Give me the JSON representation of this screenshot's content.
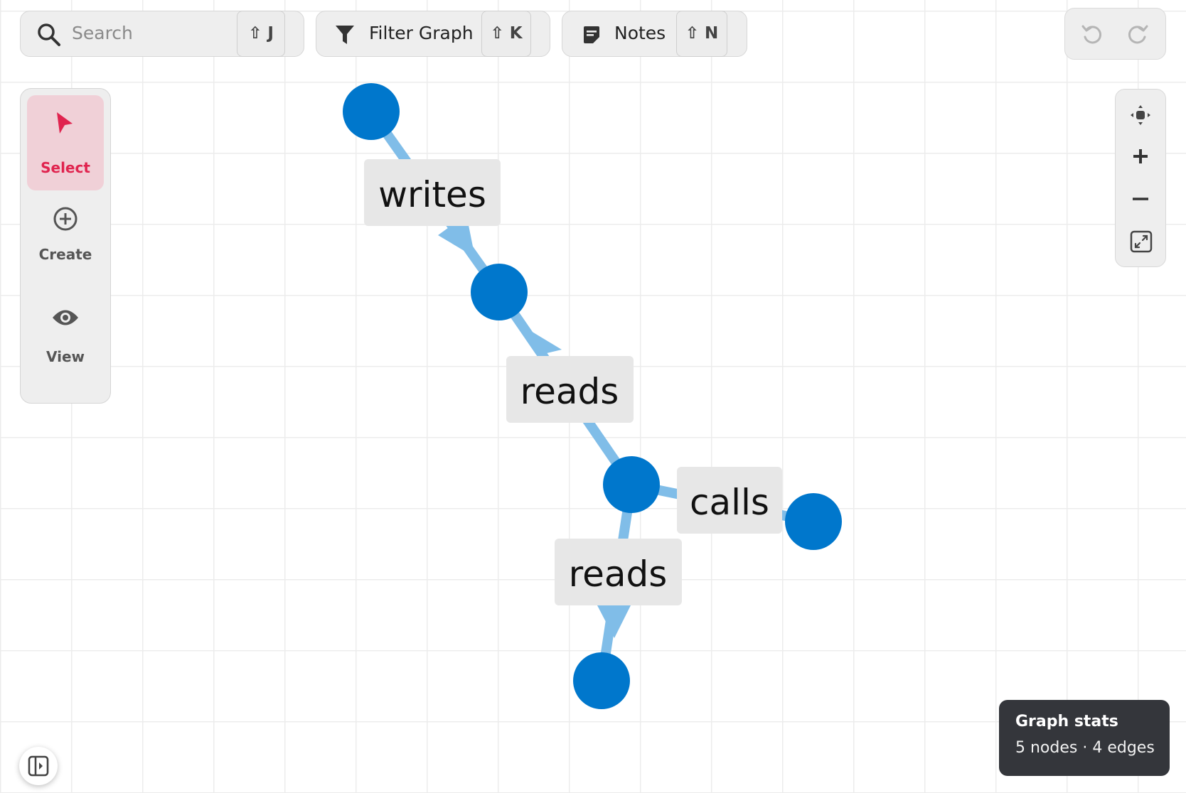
{
  "toolbar": {
    "search": {
      "placeholder": "Search",
      "shortcut": "⇧ J"
    },
    "filter": {
      "label": "Filter Graph",
      "shortcut": "⇧ K"
    },
    "notes": {
      "label": "Notes",
      "shortcut": "⇧ N"
    }
  },
  "history": {
    "undo_icon": "undo-icon",
    "redo_icon": "redo-icon"
  },
  "tools": [
    {
      "label": "Select",
      "icon": "cursor-icon",
      "active": true
    },
    {
      "label": "Create",
      "icon": "plus-circle-icon",
      "active": false
    },
    {
      "label": "View",
      "icon": "eye-icon",
      "active": false
    }
  ],
  "zoom_controls": [
    "recenter-icon",
    "zoom-in-icon",
    "zoom-out-icon",
    "fit-screen-icon"
  ],
  "graph": {
    "edges": [
      {
        "label": "writes"
      },
      {
        "label": "reads"
      },
      {
        "label": "calls"
      },
      {
        "label": "reads"
      }
    ]
  },
  "stats": {
    "title": "Graph stats",
    "summary": "5 nodes · 4 edges"
  },
  "colors": {
    "node": "#0077cc",
    "edge": "#80bde8",
    "accent": "#e0244f",
    "stats_bg": "#34363b"
  }
}
